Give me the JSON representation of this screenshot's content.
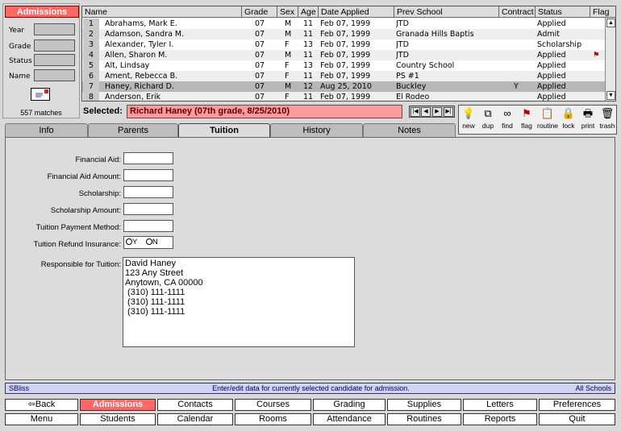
{
  "app": {
    "module_title": "Admissions",
    "matches": "557 matches"
  },
  "filters": [
    {
      "label": "Year",
      "value": ""
    },
    {
      "label": "Grade",
      "value": ""
    },
    {
      "label": "Status",
      "value": ""
    },
    {
      "label": "Name",
      "value": ""
    }
  ],
  "table": {
    "columns": [
      "Name",
      "Grade",
      "Sex",
      "Age",
      "Date Applied",
      "Prev School",
      "Contract",
      "Status",
      "Flag"
    ],
    "rows": [
      {
        "n": "1",
        "name": "Abrahams, Mark E.",
        "grade": "07",
        "sex": "M",
        "age": "11",
        "date": "Feb 07, 1999",
        "school": "JTD",
        "contract": "",
        "status": "Applied",
        "flag": ""
      },
      {
        "n": "2",
        "name": "Adamson, Sandra M.",
        "grade": "07",
        "sex": "M",
        "age": "11",
        "date": "Feb 07, 1999",
        "school": "Granada Hills Baptis",
        "contract": "",
        "status": "Admit",
        "flag": ""
      },
      {
        "n": "3",
        "name": "Alexander, Tyler I.",
        "grade": "07",
        "sex": "F",
        "age": "13",
        "date": "Feb 07, 1999",
        "school": "JTD",
        "contract": "",
        "status": "Scholarship",
        "flag": ""
      },
      {
        "n": "4",
        "name": "Allen, Sharon M.",
        "grade": "07",
        "sex": "M",
        "age": "11",
        "date": "Feb 07, 1999",
        "school": "JTD",
        "contract": "",
        "status": "Applied",
        "flag": "flag"
      },
      {
        "n": "5",
        "name": "Alt, Lindsay",
        "grade": "07",
        "sex": "F",
        "age": "13",
        "date": "Feb 07, 1999",
        "school": "Country School",
        "contract": "",
        "status": "Applied",
        "flag": ""
      },
      {
        "n": "6",
        "name": "Ament, Rebecca B.",
        "grade": "07",
        "sex": "F",
        "age": "11",
        "date": "Feb 07, 1999",
        "school": "PS #1",
        "contract": "",
        "status": "Applied",
        "flag": ""
      },
      {
        "n": "7",
        "name": "Haney, Richard D.",
        "grade": "07",
        "sex": "M",
        "age": "12",
        "date": "Aug 25, 2010",
        "school": "Buckley",
        "contract": "Y",
        "status": "Applied",
        "flag": ""
      },
      {
        "n": "8",
        "name": "Anderson, Erik",
        "grade": "07",
        "sex": "F",
        "age": "11",
        "date": "Feb 07, 1999",
        "school": "El Rodeo",
        "contract": "",
        "status": "Applied",
        "flag": ""
      }
    ]
  },
  "selected": {
    "label": "Selected:",
    "value": "Richard Haney (07th grade, 8/25/2010)"
  },
  "tools": [
    {
      "label": "new",
      "icon": "lightbulb-icon"
    },
    {
      "label": "dup",
      "icon": "duplicate-icon"
    },
    {
      "label": "find",
      "icon": "glasses-icon"
    },
    {
      "label": "flag",
      "icon": "flag-icon"
    },
    {
      "label": "routine",
      "icon": "clipboard-icon"
    },
    {
      "label": "lock",
      "icon": "lock-icon"
    },
    {
      "label": "print",
      "icon": "printer-icon"
    },
    {
      "label": "trash",
      "icon": "trash-icon"
    }
  ],
  "tabs": [
    "Info",
    "Parents",
    "Tuition",
    "History",
    "Notes"
  ],
  "active_tab": "Tuition",
  "tuition": {
    "fields": [
      {
        "label": "Financial Aid:",
        "value": ""
      },
      {
        "label": "Financial Aid Amount:",
        "value": ""
      },
      {
        "label": "Scholarship:",
        "value": ""
      },
      {
        "label": "Scholarship Amount:",
        "value": ""
      },
      {
        "label": "Tuition Payment Method:",
        "value": ""
      }
    ],
    "refund_label": "Tuition Refund Insurance:",
    "refund_yes": "Y",
    "refund_no": "N",
    "responsible_label": "Responsible for Tuition:",
    "responsible_lines": [
      "David Haney",
      "123 Any Street",
      "Anytown, CA 00000",
      " (310) 111-1111",
      " (310) 111-1111",
      " (310) 111-1111"
    ]
  },
  "status_bar": {
    "left": "SBliss",
    "center": "Enter/edit data for currently selected candidate for admission.",
    "right": "All Schools"
  },
  "menu_row1": [
    "Back",
    "Admissions",
    "Contacts",
    "Courses",
    "Grading",
    "Supplies",
    "Letters",
    "Preferences"
  ],
  "menu_row2": [
    "Menu",
    "Students",
    "Calendar",
    "Rooms",
    "Attendance",
    "Routines",
    "Reports",
    "Quit"
  ],
  "colors": {
    "accent": "#ff6666",
    "selected_field": "#ff9a9a",
    "status_bar": "#cfd4f0"
  }
}
